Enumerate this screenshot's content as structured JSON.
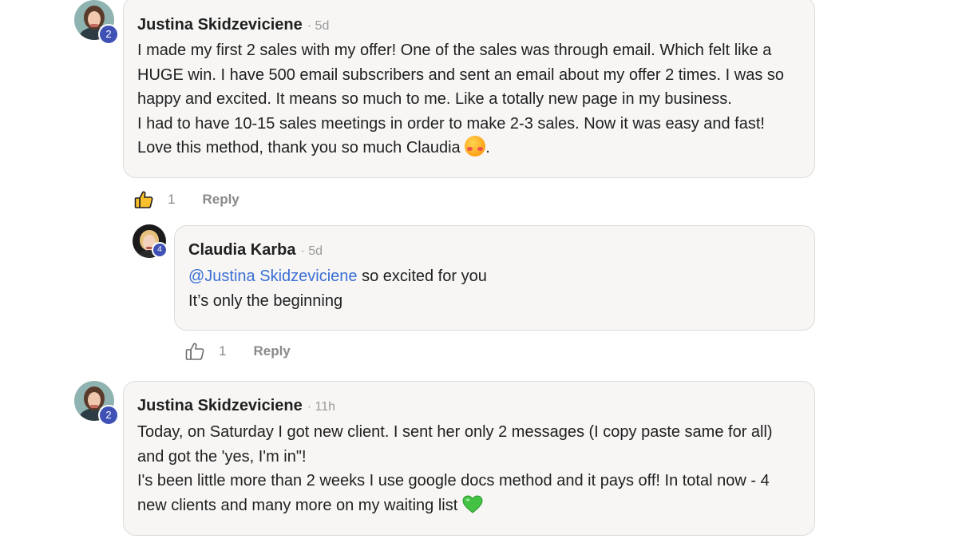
{
  "comments": [
    {
      "author": "Justina Skidzeviciene",
      "time": "· 5d",
      "level": "2",
      "lines": [
        "I made my first 2 sales with my offer! One of the sales was through email. Which felt like a",
        "HUGE win. I have 500 email subscribers and sent an email about my offer 2 times. I was so",
        "happy and excited. It means so much to me. Like a totally new page in my business.",
        "I had to have 10-15 sales meetings in order to make 2-3 sales. Now it was easy and fast!"
      ],
      "last_line": "Love this method, thank you so much Claudia",
      "last_line_suffix": ".",
      "emoji": "smiling-face-with-hearts",
      "likes": "1",
      "reply_label": "Reply",
      "liked": true
    },
    {
      "author": "Claudia Karba",
      "time": "· 5d",
      "level": "4",
      "mention": "@Justina Skidzeviciene",
      "line1_rest": " so excited for you",
      "line2": "It’s only the beginning",
      "likes": "1",
      "reply_label": "Reply",
      "liked": false
    },
    {
      "author": "Justina Skidzeviciene",
      "time": "· 11h",
      "level": "2",
      "lines": [
        "Today, on Saturday I got new client. I sent her only 2 messages (I copy paste same for all)",
        "and got the 'yes, I'm in\"!",
        "I's been little more than 2 weeks I use google docs method and it pays off! In total now - 4"
      ],
      "last_line": "new clients and many more on my waiting list",
      "emoji": "green-heart"
    }
  ],
  "colors": {
    "bubble_bg": "#f7f6f5",
    "bubble_border": "#dedcd9",
    "mention": "#3b6fd4",
    "badge": "#3f51b5",
    "meta": "#8a8a8a"
  }
}
